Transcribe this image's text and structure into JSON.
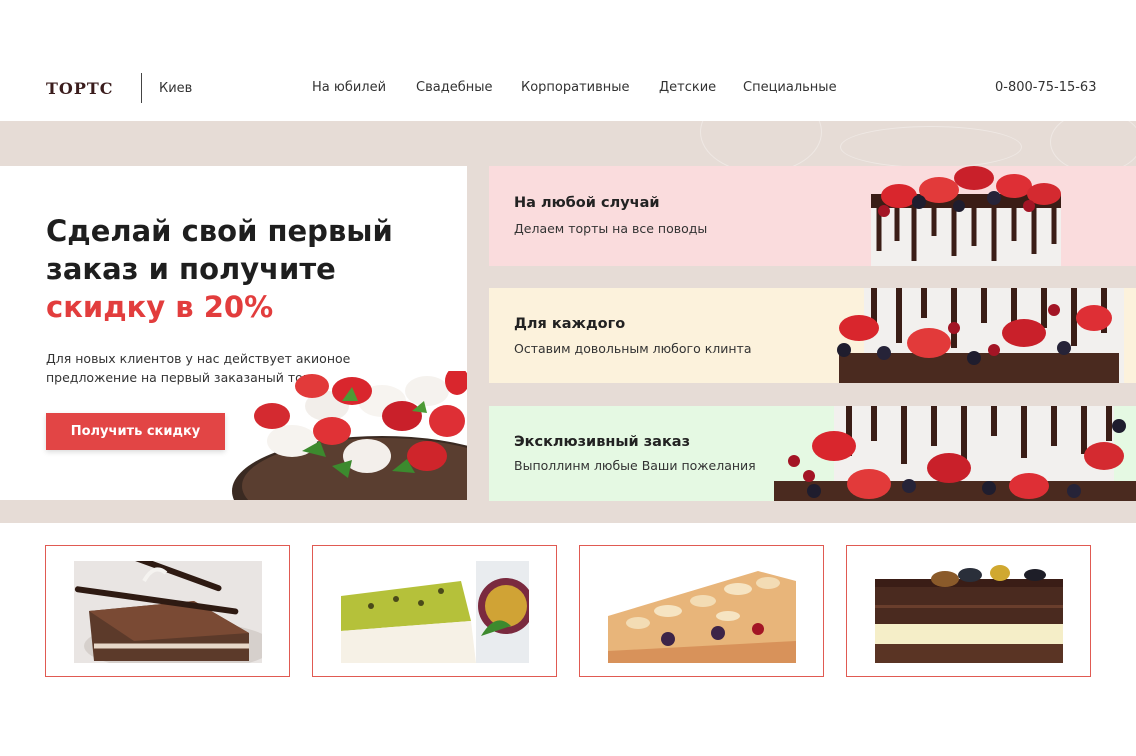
{
  "header": {
    "logo": "ТОРТС",
    "city": "Киев",
    "nav": [
      "На юбилей",
      "Свадебные",
      "Корпоративные",
      "Детские",
      "Специальные"
    ],
    "phone": "0-800-75-15-63"
  },
  "promo": {
    "title_line1": "Сделай свой первый",
    "title_line2": "заказ и получите",
    "title_accent": "скидку в 20%",
    "text": "Для новых клиентов у нас действует акионое предложение на первый заказаный торт",
    "button": "Получить скидку"
  },
  "cards": [
    {
      "title": "На любой случай",
      "subtitle": "Делаем торты на все поводы",
      "color": "#fadcdd"
    },
    {
      "title": "Для каждого",
      "subtitle": "Оставим довольным любого клинта",
      "color": "#fcf2dc"
    },
    {
      "title": "Эксклюзивный заказ",
      "subtitle": "Выполлинм любые Ваши пожелания",
      "color": "#e5f9e3"
    }
  ],
  "products": [
    {
      "name": "chocolate-cake-slice"
    },
    {
      "name": "passion-fruit-cake"
    },
    {
      "name": "almond-berry-cake"
    },
    {
      "name": "chocolate-layer-cake"
    }
  ],
  "colors": {
    "accent": "#e24545",
    "band": "#e6dcd6",
    "border": "#e05a52"
  }
}
